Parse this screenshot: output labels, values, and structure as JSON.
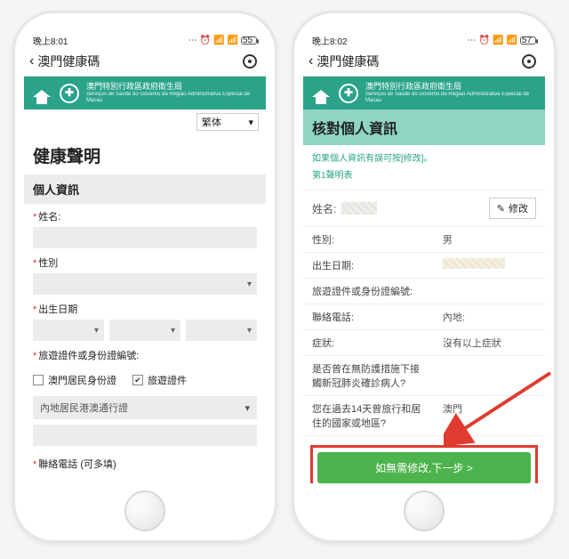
{
  "status": {
    "time_left": "晚上8:01",
    "time_right": "晚上8:02",
    "battery_left": "55",
    "battery_right": "57"
  },
  "nav": {
    "title": "澳門健康碼"
  },
  "header": {
    "line1": "澳門特別行政區政府衛生局",
    "line2": "Serviços de Saúde do Governo da Região Administrativa Especial de Macau"
  },
  "lang_selected": "繁体",
  "left": {
    "page_title": "健康聲明",
    "section_title": "個人資訊",
    "labels": {
      "name": "姓名:",
      "gender": "性別",
      "birth": "出生日期",
      "doc": "旅遊證件或身份證編號:",
      "phone": "聯絡電話 (可多填)"
    },
    "checks": {
      "macau_id": "澳門居民身份證",
      "travel_doc": "旅遊證件"
    },
    "dropdown_doc_type": "內地居民港澳通行證"
  },
  "right": {
    "page_title": "核對個人資訊",
    "hint1": "如果個人資訊有誤可按[修改]。",
    "hint2": "第1聲明表",
    "name_label": "姓名:",
    "edit_btn": "修改",
    "rows": [
      {
        "k": "性別:",
        "v": "男"
      },
      {
        "k": "出生日期:",
        "v": ""
      },
      {
        "k": "旅遊證件或身份證編號:",
        "v": ""
      },
      {
        "k": "聯絡電話:",
        "v": "內地:"
      },
      {
        "k": "症狀:",
        "v": "沒有以上症狀"
      },
      {
        "k": "是否曾在無防護措施下接觸新冠肺炎確診病人?",
        "v": ""
      },
      {
        "k": "您在過去14天曾旅行和居住的國家或地區?",
        "v": "澳門"
      }
    ],
    "cta": "如無需修改,下一步 >"
  }
}
